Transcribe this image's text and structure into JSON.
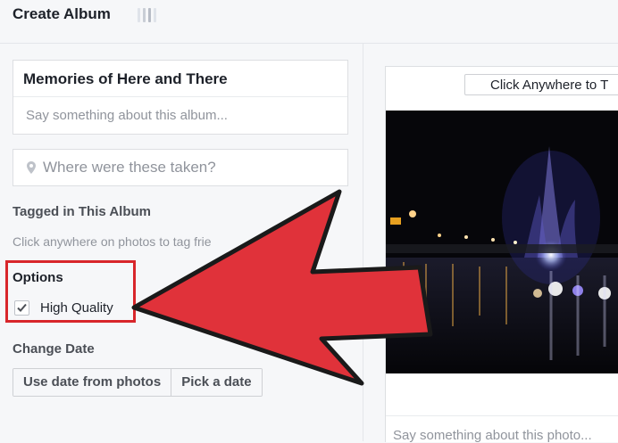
{
  "header": {
    "title": "Create Album"
  },
  "album": {
    "name": "Memories of Here and There",
    "description_placeholder": "Say something about this album..."
  },
  "location": {
    "placeholder": "Where were these taken?"
  },
  "tagged": {
    "heading": "Tagged in This Album",
    "hint": "Click anywhere on photos to tag frie"
  },
  "options": {
    "heading": "Options",
    "high_quality_label": "High Quality",
    "high_quality_checked": true
  },
  "change_date": {
    "heading": "Change Date",
    "use_date_label": "Use date from photos",
    "pick_date_label": "Pick a date"
  },
  "photo_panel": {
    "click_anywhere_label": "Click Anywhere to T",
    "caption_placeholder": "Say something about this photo..."
  },
  "colors": {
    "highlight_red": "#d8262b",
    "arrow_red": "#e0323a"
  }
}
